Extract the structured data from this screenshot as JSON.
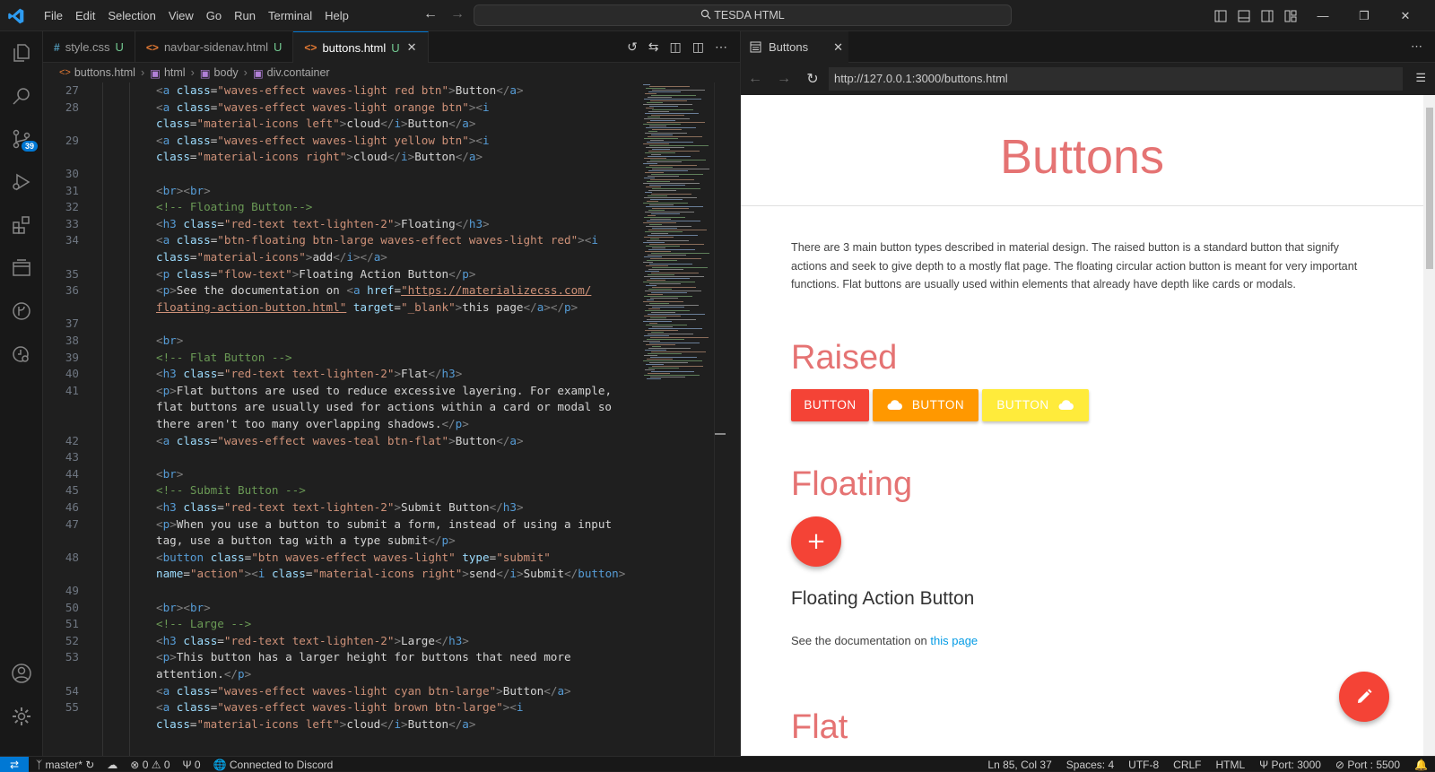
{
  "titlebar": {
    "menus": [
      "File",
      "Edit",
      "Selection",
      "View",
      "Go",
      "Run",
      "Terminal",
      "Help"
    ],
    "search": "TESDA HTML"
  },
  "activity": {
    "scm_badge": "39"
  },
  "tabs": [
    {
      "icon": "#",
      "label": "style.css",
      "status": "U"
    },
    {
      "icon": "<>",
      "label": "navbar-sidenav.html",
      "status": "U"
    },
    {
      "icon": "<>",
      "label": "buttons.html",
      "status": "U"
    }
  ],
  "breadcrumb": [
    "buttons.html",
    "html",
    "body",
    "div.container"
  ],
  "code": {
    "lines": [
      {
        "n": "27",
        "html": "<span class=\"tag\">&lt;</span><span class=\"tn\">a</span> <span class=\"at\">class</span>=<span class=\"st\">\"waves-effect waves-light red btn\"</span><span class=\"tag\">&gt;</span><span class=\"tx\">Button</span><span class=\"tag\">&lt;/</span><span class=\"tn\">a</span><span class=\"tag\">&gt;</span>"
      },
      {
        "n": "28",
        "html": "<span class=\"tag\">&lt;</span><span class=\"tn\">a</span> <span class=\"at\">class</span>=<span class=\"st\">\"waves-effect waves-light orange btn\"</span><span class=\"tag\">&gt;&lt;</span><span class=\"tn\">i</span>"
      },
      {
        "n": "",
        "html": "<span class=\"at\">class</span>=<span class=\"st\">\"material-icons left\"</span><span class=\"tag\">&gt;</span><span class=\"tx\">cloud</span><span class=\"tag\">&lt;/</span><span class=\"tn\">i</span><span class=\"tag\">&gt;</span><span class=\"tx\">Button</span><span class=\"tag\">&lt;/</span><span class=\"tn\">a</span><span class=\"tag\">&gt;</span>"
      },
      {
        "n": "29",
        "html": "<span class=\"tag\">&lt;</span><span class=\"tn\">a</span> <span class=\"at\">class</span>=<span class=\"st\">\"waves-effect waves-light yellow btn\"</span><span class=\"tag\">&gt;&lt;</span><span class=\"tn\">i</span>"
      },
      {
        "n": "",
        "html": "<span class=\"at\">class</span>=<span class=\"st\">\"material-icons right\"</span><span class=\"tag\">&gt;</span><span class=\"tx\">cloud</span><span class=\"tag\">&lt;/</span><span class=\"tn\">i</span><span class=\"tag\">&gt;</span><span class=\"tx\">Button</span><span class=\"tag\">&lt;/</span><span class=\"tn\">a</span><span class=\"tag\">&gt;</span>"
      },
      {
        "n": "30",
        "html": ""
      },
      {
        "n": "31",
        "html": "<span class=\"tag\">&lt;</span><span class=\"tn\">br</span><span class=\"tag\">&gt;&lt;</span><span class=\"tn\">br</span><span class=\"tag\">&gt;</span>"
      },
      {
        "n": "32",
        "html": "<span class=\"cm\">&lt;!-- Floating Button--&gt;</span>"
      },
      {
        "n": "33",
        "html": "<span class=\"tag\">&lt;</span><span class=\"tn\">h3</span> <span class=\"at\">class</span>=<span class=\"st\">\"red-text text-lighten-2\"</span><span class=\"tag\">&gt;</span><span class=\"tx\">Floating</span><span class=\"tag\">&lt;/</span><span class=\"tn\">h3</span><span class=\"tag\">&gt;</span>"
      },
      {
        "n": "34",
        "html": "<span class=\"tag\">&lt;</span><span class=\"tn\">a</span> <span class=\"at\">class</span>=<span class=\"st\">\"btn-floating btn-large waves-effect waves-light red\"</span><span class=\"tag\">&gt;&lt;</span><span class=\"tn\">i</span>"
      },
      {
        "n": "",
        "html": "<span class=\"at\">class</span>=<span class=\"st\">\"material-icons\"</span><span class=\"tag\">&gt;</span><span class=\"tx\">add</span><span class=\"tag\">&lt;/</span><span class=\"tn\">i</span><span class=\"tag\">&gt;&lt;/</span><span class=\"tn\">a</span><span class=\"tag\">&gt;</span>"
      },
      {
        "n": "35",
        "html": "<span class=\"tag\">&lt;</span><span class=\"tn\">p</span> <span class=\"at\">class</span>=<span class=\"st\">\"flow-text\"</span><span class=\"tag\">&gt;</span><span class=\"tx\">Floating Action Button</span><span class=\"tag\">&lt;/</span><span class=\"tn\">p</span><span class=\"tag\">&gt;</span>"
      },
      {
        "n": "36",
        "html": "<span class=\"tag\">&lt;</span><span class=\"tn\">p</span><span class=\"tag\">&gt;</span><span class=\"tx\">See the documentation on </span><span class=\"tag\">&lt;</span><span class=\"tn\">a</span> <span class=\"at\">href</span>=<span class=\"lk\">\"https://materializecss.com/</span>"
      },
      {
        "n": "",
        "html": "<span class=\"lk\">floating-action-button.html\"</span> <span class=\"at\">target</span>=<span class=\"st\">\"_blank\"</span><span class=\"tag\">&gt;</span><span class=\"tx\">this page</span><span class=\"tag\">&lt;/</span><span class=\"tn\">a</span><span class=\"tag\">&gt;&lt;/</span><span class=\"tn\">p</span><span class=\"tag\">&gt;</span>"
      },
      {
        "n": "37",
        "html": ""
      },
      {
        "n": "38",
        "html": "<span class=\"tag\">&lt;</span><span class=\"tn\">br</span><span class=\"tag\">&gt;</span>"
      },
      {
        "n": "39",
        "html": "<span class=\"cm\">&lt;!-- Flat Button --&gt;</span>"
      },
      {
        "n": "40",
        "html": "<span class=\"tag\">&lt;</span><span class=\"tn\">h3</span> <span class=\"at\">class</span>=<span class=\"st\">\"red-text text-lighten-2\"</span><span class=\"tag\">&gt;</span><span class=\"tx\">Flat</span><span class=\"tag\">&lt;/</span><span class=\"tn\">h3</span><span class=\"tag\">&gt;</span>"
      },
      {
        "n": "41",
        "html": "<span class=\"tag\">&lt;</span><span class=\"tn\">p</span><span class=\"tag\">&gt;</span><span class=\"tx\">Flat buttons are used to reduce excessive layering. For example,</span>"
      },
      {
        "n": "",
        "html": "<span class=\"tx\">flat buttons are usually used for actions within a card or modal so</span>"
      },
      {
        "n": "",
        "html": "<span class=\"tx\">there aren't too many overlapping shadows.</span><span class=\"tag\">&lt;/</span><span class=\"tn\">p</span><span class=\"tag\">&gt;</span>"
      },
      {
        "n": "42",
        "html": "<span class=\"tag\">&lt;</span><span class=\"tn\">a</span> <span class=\"at\">class</span>=<span class=\"st\">\"waves-effect waves-teal btn-flat\"</span><span class=\"tag\">&gt;</span><span class=\"tx\">Button</span><span class=\"tag\">&lt;/</span><span class=\"tn\">a</span><span class=\"tag\">&gt;</span>"
      },
      {
        "n": "43",
        "html": ""
      },
      {
        "n": "44",
        "html": "<span class=\"tag\">&lt;</span><span class=\"tn\">br</span><span class=\"tag\">&gt;</span>"
      },
      {
        "n": "45",
        "html": "<span class=\"cm\">&lt;!-- Submit Button --&gt;</span>"
      },
      {
        "n": "46",
        "html": "<span class=\"tag\">&lt;</span><span class=\"tn\">h3</span> <span class=\"at\">class</span>=<span class=\"st\">\"red-text text-lighten-2\"</span><span class=\"tag\">&gt;</span><span class=\"tx\">Submit Button</span><span class=\"tag\">&lt;/</span><span class=\"tn\">h3</span><span class=\"tag\">&gt;</span>"
      },
      {
        "n": "47",
        "html": "<span class=\"tag\">&lt;</span><span class=\"tn\">p</span><span class=\"tag\">&gt;</span><span class=\"tx\">When you use a button to submit a form, instead of using a input</span>"
      },
      {
        "n": "",
        "html": "<span class=\"tx\">tag, use a button tag with a type submit</span><span class=\"tag\">&lt;/</span><span class=\"tn\">p</span><span class=\"tag\">&gt;</span>"
      },
      {
        "n": "48",
        "html": "<span class=\"tag\">&lt;</span><span class=\"tn\">button</span> <span class=\"at\">class</span>=<span class=\"st\">\"btn waves-effect waves-light\"</span> <span class=\"at\">type</span>=<span class=\"st\">\"submit\"</span>"
      },
      {
        "n": "",
        "html": "<span class=\"at\">name</span>=<span class=\"st\">\"action\"</span><span class=\"tag\">&gt;&lt;</span><span class=\"tn\">i</span> <span class=\"at\">class</span>=<span class=\"st\">\"material-icons right\"</span><span class=\"tag\">&gt;</span><span class=\"tx\">send</span><span class=\"tag\">&lt;/</span><span class=\"tn\">i</span><span class=\"tag\">&gt;</span><span class=\"tx\">Submit</span><span class=\"tag\">&lt;/</span><span class=\"tn\">button</span><span class=\"tag\">&gt;</span>"
      },
      {
        "n": "49",
        "html": ""
      },
      {
        "n": "50",
        "html": "<span class=\"tag\">&lt;</span><span class=\"tn\">br</span><span class=\"tag\">&gt;&lt;</span><span class=\"tn\">br</span><span class=\"tag\">&gt;</span>"
      },
      {
        "n": "51",
        "html": "<span class=\"cm\">&lt;!-- Large --&gt;</span>"
      },
      {
        "n": "52",
        "html": "<span class=\"tag\">&lt;</span><span class=\"tn\">h3</span> <span class=\"at\">class</span>=<span class=\"st\">\"red-text text-lighten-2\"</span><span class=\"tag\">&gt;</span><span class=\"tx\">Large</span><span class=\"tag\">&lt;/</span><span class=\"tn\">h3</span><span class=\"tag\">&gt;</span>"
      },
      {
        "n": "53",
        "html": "<span class=\"tag\">&lt;</span><span class=\"tn\">p</span><span class=\"tag\">&gt;</span><span class=\"tx\">This button has a larger height for buttons that need more</span>"
      },
      {
        "n": "",
        "html": "<span class=\"tx\">attention.</span><span class=\"tag\">&lt;/</span><span class=\"tn\">p</span><span class=\"tag\">&gt;</span>"
      },
      {
        "n": "54",
        "html": "<span class=\"tag\">&lt;</span><span class=\"tn\">a</span> <span class=\"at\">class</span>=<span class=\"st\">\"waves-effect waves-light cyan btn-large\"</span><span class=\"tag\">&gt;</span><span class=\"tx\">Button</span><span class=\"tag\">&lt;/</span><span class=\"tn\">a</span><span class=\"tag\">&gt;</span>"
      },
      {
        "n": "55",
        "html": "<span class=\"tag\">&lt;</span><span class=\"tn\">a</span> <span class=\"at\">class</span>=<span class=\"st\">\"waves-effect waves-light brown btn-large\"</span><span class=\"tag\">&gt;&lt;</span><span class=\"tn\">i</span>"
      },
      {
        "n": "",
        "html": "<span class=\"at\">class</span>=<span class=\"st\">\"material-icons left\"</span><span class=\"tag\">&gt;</span><span class=\"tx\">cloud</span><span class=\"tag\">&lt;/</span><span class=\"tn\">i</span><span class=\"tag\">&gt;</span><span class=\"tx\">Button</span><span class=\"tag\">&lt;/</span><span class=\"tn\">a</span><span class=\"tag\">&gt;</span>"
      }
    ]
  },
  "preview": {
    "tab_label": "Buttons",
    "url": "http://127.0.0.1:3000/buttons.html",
    "page_title": "Buttons",
    "description": "There are 3 main button types described in material design. The raised button is a standard button that signify actions and seek to give depth to a mostly flat page. The floating circular action button is meant for very important functions. Flat buttons are usually used within elements that already have depth like cards or modals.",
    "raised_heading": "Raised",
    "raised_buttons": [
      "BUTTON",
      "BUTTON",
      "BUTTON"
    ],
    "floating_heading": "Floating",
    "fab_symbol": "+",
    "flow_text": "Floating Action Button",
    "doc_prefix": "See the documentation on ",
    "doc_link": "this page",
    "flat_heading": "Flat",
    "colors": {
      "red": "#f44336",
      "orange": "#ff9800",
      "yellow": "#ffeb3b",
      "heading": "#e57373"
    }
  },
  "status": {
    "branch": "master*",
    "problems": "0",
    "warnings": "0",
    "ports": "0",
    "discord": "Connected to Discord",
    "position": "Ln 85, Col 37",
    "spaces": "Spaces: 4",
    "encoding": "UTF-8",
    "eol": "CRLF",
    "language": "HTML",
    "port": "Port: 3000",
    "port2": "Port : 5500"
  }
}
